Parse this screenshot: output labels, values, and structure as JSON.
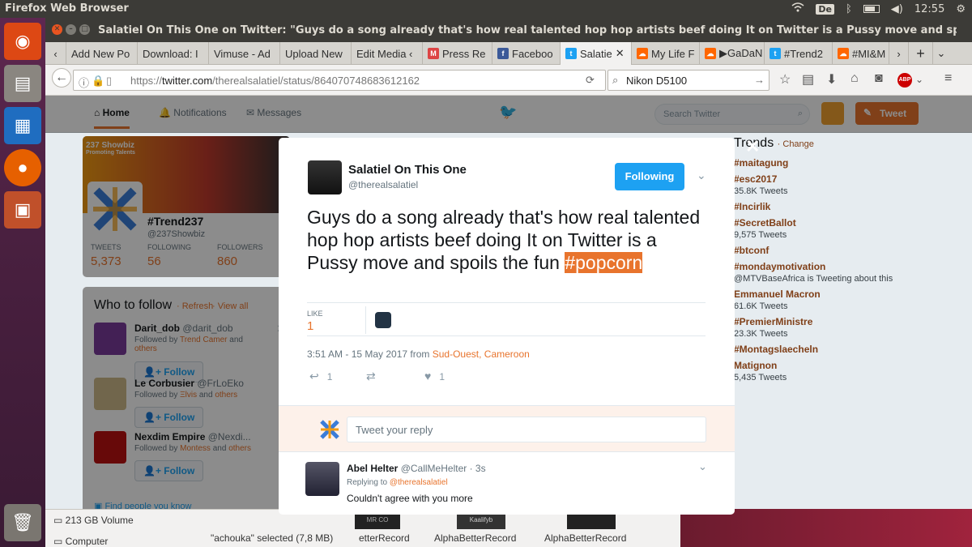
{
  "os": {
    "app_name": "Firefox Web Browser",
    "kbd": "De",
    "clock": "12:55"
  },
  "window": {
    "title": "Salatiel On This One on Twitter: \"Guys do a song already that's how real talented hop hop artists beef doing It on Twitter is a Pussy move and spoils the fun #popcorn\""
  },
  "tabs": [
    {
      "label": "Add New Po",
      "color": "#888"
    },
    {
      "label": "Download: I",
      "color": "#888"
    },
    {
      "label": "Vimuse - Ad",
      "color": "#888"
    },
    {
      "label": "Upload New",
      "color": "#888"
    },
    {
      "label": "Edit Media ‹",
      "color": "#888"
    },
    {
      "label": "Press Re",
      "color": "#d44"
    },
    {
      "label": "Faceboo",
      "color": "#3b5998"
    },
    {
      "label": "Salatie",
      "color": "#1da1f2"
    },
    {
      "label": "My Life F",
      "color": "#f60"
    },
    {
      "label": "▶GaDaN",
      "color": "#f60"
    },
    {
      "label": "#Trend2",
      "color": "#1da1f2"
    },
    {
      "label": "#MI&M",
      "color": "#f60"
    }
  ],
  "nav": {
    "url_prefix": "https://",
    "url_host": "twitter.com",
    "url_path": "/therealsalatiel/status/864070748683612162",
    "search_value": "Nikon D5100"
  },
  "twitter_nav": {
    "home": "Home",
    "notifications": "Notifications",
    "messages": "Messages",
    "search_placeholder": "Search Twitter",
    "tweet_button": "Tweet"
  },
  "profile": {
    "name": "#Trend237",
    "handle": "@237Showbiz",
    "tweets_label": "TWEETS",
    "tweets": "5,373",
    "following_label": "FOLLOWING",
    "following": "56",
    "followers_label": "FOLLOWERS",
    "followers": "860",
    "banner_logo_text": "237 Showbiz",
    "banner_tagline": "Promoting Talents"
  },
  "who_to_follow": {
    "title": "Who to follow",
    "refresh": "· Refresh",
    "view_all": "· View all",
    "follow_label": "Follow",
    "find_people": "Find people you know",
    "users": [
      {
        "name": "Darit_dob",
        "handle": "@darit_dob",
        "followed_prefix": "Followed by",
        "followed_by": "Trend Camer",
        "followed_suffix": "and",
        "followed_extra": "others"
      },
      {
        "name": "Le Corbusier",
        "handle": "@FrLoEko",
        "followed_prefix": "Followed by",
        "followed_by": "Ξlvis",
        "followed_suffix": "and",
        "followed_extra": "others"
      },
      {
        "name": "Nexdim Empire",
        "handle": "@Nexdi...",
        "followed_prefix": "Followed by",
        "followed_by": "Montess",
        "followed_suffix": "and",
        "followed_extra": "others"
      }
    ]
  },
  "trends": {
    "title": "Trends",
    "change": "· Change",
    "items": [
      {
        "tag": "#maitagung",
        "sub": ""
      },
      {
        "tag": "#esc2017",
        "sub": "35.8K Tweets"
      },
      {
        "tag": "#Incirlik",
        "sub": ""
      },
      {
        "tag": "#SecretBallot",
        "sub": "9,575 Tweets"
      },
      {
        "tag": "#btconf",
        "sub": ""
      },
      {
        "tag": "#mondaymotivation",
        "sub": "@MTVBaseAfrica is Tweeting about this"
      },
      {
        "tag": "Emmanuel Macron",
        "sub": "61.6K Tweets"
      },
      {
        "tag": "#PremierMinistre",
        "sub": "23.3K Tweets"
      },
      {
        "tag": "#Montagslaecheln",
        "sub": ""
      },
      {
        "tag": "Matignon",
        "sub": "5,435 Tweets"
      }
    ]
  },
  "tweet": {
    "author": "Salatiel On This One",
    "handle": "@therealsalatiel",
    "following_button": "Following",
    "text": "Guys do a song already that's how real talented hop hop artists beef doing It on Twitter is a Pussy move and spoils the fun",
    "hashtag": "#popcorn",
    "likes_label": "LIKE",
    "likes": "1",
    "timestamp": "3:51 AM - 15 May 2017 from",
    "location": "Sud-Ouest, Cameroon",
    "reply_count": "1",
    "like_count": "1"
  },
  "reply_box": {
    "placeholder": "Tweet your reply"
  },
  "reply": {
    "name": "Abel Helter",
    "handle": "@CallMeHelter",
    "time": "· 3s",
    "replying_to_label": "Replying to",
    "replying_to": "@therealsalatiel",
    "text": "Couldn't agree with you more"
  },
  "files": {
    "volume": "213 GB Volume",
    "computer": "Computer",
    "selected": "\"achouka\" selected  (7,8 MB)",
    "f1": "etterRecord",
    "f2": "AlphaBetterRecord",
    "f3": "AlphaBetterRecord",
    "f1_logo": "MR CO",
    "f2_logo": "Kaalifyb"
  }
}
